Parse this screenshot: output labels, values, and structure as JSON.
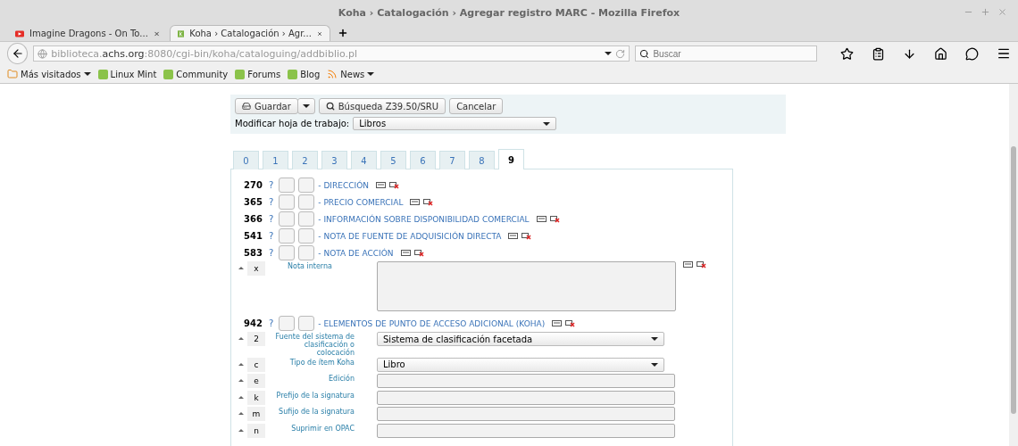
{
  "window": {
    "title": "Koha › Catalogación › Agregar registro MARC - Mozilla Firefox"
  },
  "browser_tabs": [
    {
      "title": "Imagine Dragons - On To...",
      "kind": "video",
      "selected": false
    },
    {
      "title": "Koha › Catalogación › Agr...",
      "kind": "koha",
      "selected": true
    }
  ],
  "address_bar": {
    "url": "biblioteca.**achs.org**:8080/cgi-bin/koha/cataloguing/addbiblio.pl"
  },
  "search": {
    "placeholder": "Buscar"
  },
  "bookmarks": [
    {
      "label": "Más visitados",
      "kind": "folder",
      "dropdown": true
    },
    {
      "label": "Linux Mint",
      "kind": "mint",
      "dropdown": false
    },
    {
      "label": "Community",
      "kind": "mint",
      "dropdown": false
    },
    {
      "label": "Forums",
      "kind": "mint",
      "dropdown": false
    },
    {
      "label": "Blog",
      "kind": "mint",
      "dropdown": false
    },
    {
      "label": "News",
      "kind": "rss",
      "dropdown": true
    }
  ],
  "toolbar": {
    "save": "Guardar",
    "z3950": "Búsqueda Z39.50/SRU",
    "cancel": "Cancelar",
    "framework_label": "Modificar hoja de trabajo:",
    "framework_value": "Libros"
  },
  "marc_tabs": [
    {
      "label": "0",
      "selected": false
    },
    {
      "label": "1",
      "selected": false
    },
    {
      "label": "2",
      "selected": false
    },
    {
      "label": "3",
      "selected": false
    },
    {
      "label": "4",
      "selected": false
    },
    {
      "label": "5",
      "selected": false
    },
    {
      "label": "6",
      "selected": false
    },
    {
      "label": "7",
      "selected": false
    },
    {
      "label": "8",
      "selected": false
    },
    {
      "label": "9",
      "selected": true
    }
  ],
  "fields": [
    {
      "tag": "270",
      "help": "?",
      "title": "- DIRECCIÓN"
    },
    {
      "tag": "365",
      "help": "?",
      "title": "- PRECIO COMERCIAL"
    },
    {
      "tag": "366",
      "help": "?",
      "title": "- INFORMACIÓN SOBRE DISPONIBILIDAD COMERCIAL"
    },
    {
      "tag": "541",
      "help": "?",
      "title": "- NOTA DE FUENTE DE ADQUISICIÓN DIRECTA"
    },
    {
      "tag": "583",
      "help": "?",
      "title": "- NOTA DE ACCIÓN",
      "subfields": [
        {
          "code": "x",
          "label": "Nota interna",
          "kind": "textarea"
        }
      ]
    },
    {
      "tag": "942",
      "help": "?",
      "title": "- ELEMENTOS DE PUNTO DE ACCESO ADICIONAL (KOHA)",
      "subfields": [
        {
          "code": "2",
          "label": "Fuente del sistema de clasificación o colocación",
          "kind": "select",
          "value": "Sistema de clasificación facetada"
        },
        {
          "code": "c",
          "label": "Tipo de ítem Koha",
          "kind": "select",
          "value": "Libro"
        },
        {
          "code": "e",
          "label": "Edición",
          "kind": "text"
        },
        {
          "code": "k",
          "label": "Prefijo de la signatura",
          "kind": "text"
        },
        {
          "code": "m",
          "label": "Sufijo de la signatura",
          "kind": "text"
        },
        {
          "code": "n",
          "label": "Suprimir en OPAC",
          "kind": "text"
        }
      ]
    }
  ]
}
